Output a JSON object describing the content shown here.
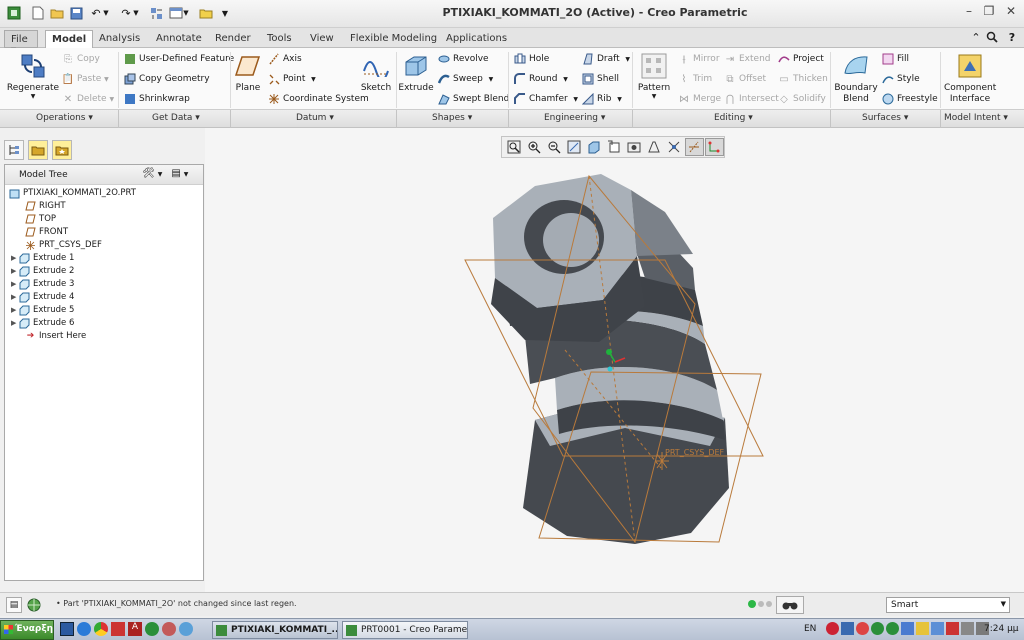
{
  "window": {
    "title": "PTIXIAKI_KOMMATI_2O (Active) - Creo Parametric"
  },
  "menu_tabs": [
    {
      "label": "File"
    },
    {
      "label": "Model"
    },
    {
      "label": "Analysis"
    },
    {
      "label": "Annotate"
    },
    {
      "label": "Render"
    },
    {
      "label": "Tools"
    },
    {
      "label": "View"
    },
    {
      "label": "Flexible Modeling"
    },
    {
      "label": "Applications"
    }
  ],
  "ribbon": {
    "regenerate": "Regenerate",
    "copy": "Copy",
    "paste": "Paste",
    "delete": "Delete",
    "user_defined_feature": "User-Defined Feature",
    "copy_geometry": "Copy Geometry",
    "shrinkwrap": "Shrinkwrap",
    "plane": "Plane",
    "axis": "Axis",
    "point": "Point",
    "coordinate_system": "Coordinate System",
    "sketch": "Sketch",
    "extrude": "Extrude",
    "revolve": "Revolve",
    "sweep": "Sweep",
    "swept_blend": "Swept Blend",
    "hole": "Hole",
    "round": "Round",
    "chamfer": "Chamfer",
    "draft": "Draft",
    "shell": "Shell",
    "rib": "Rib",
    "pattern": "Pattern",
    "mirror": "Mirror",
    "trim": "Trim",
    "merge": "Merge",
    "extend": "Extend",
    "offset": "Offset",
    "intersect": "Intersect",
    "project": "Project",
    "thicken": "Thicken",
    "solidify": "Solidify",
    "boundary_blend": "Boundary Blend",
    "fill": "Fill",
    "style": "Style",
    "freestyle": "Freestyle",
    "component_interface": "Component Interface"
  },
  "groups": [
    {
      "label": "Operations"
    },
    {
      "label": "Get Data"
    },
    {
      "label": "Datum"
    },
    {
      "label": "Shapes"
    },
    {
      "label": "Engineering"
    },
    {
      "label": "Editing"
    },
    {
      "label": "Surfaces"
    },
    {
      "label": "Model Intent"
    }
  ],
  "model_tree": {
    "header": "Model Tree",
    "items": [
      {
        "label": "PTIXIAKI_KOMMATI_2O.PRT"
      },
      {
        "label": "RIGHT"
      },
      {
        "label": "TOP"
      },
      {
        "label": "FRONT"
      },
      {
        "label": "PRT_CSYS_DEF"
      },
      {
        "label": "Extrude 1"
      },
      {
        "label": "Extrude 2"
      },
      {
        "label": "Extrude 3"
      },
      {
        "label": "Extrude 4"
      },
      {
        "label": "Extrude 5"
      },
      {
        "label": "Extrude 6"
      },
      {
        "label": "Insert Here"
      }
    ]
  },
  "viewport": {
    "csys_label": "PRT_CSYS_DEF"
  },
  "status": {
    "message": "Part 'PTIXIAKI_KOMMATI_2O' not changed since last regen.",
    "filter": "Smart"
  },
  "taskbar": {
    "start": "Έναρξη",
    "task1": "PTIXIAKI_KOMMATI_...",
    "task2": "PRT0001 - Creo Paramet...",
    "lang": "EN",
    "clock": "7:24 μμ"
  },
  "colors": {
    "part_light": "#a9b0b8",
    "part_dark": "#3c4046",
    "datum_plane": "#b97a3b",
    "ribbon_bg": "#fafafa"
  }
}
